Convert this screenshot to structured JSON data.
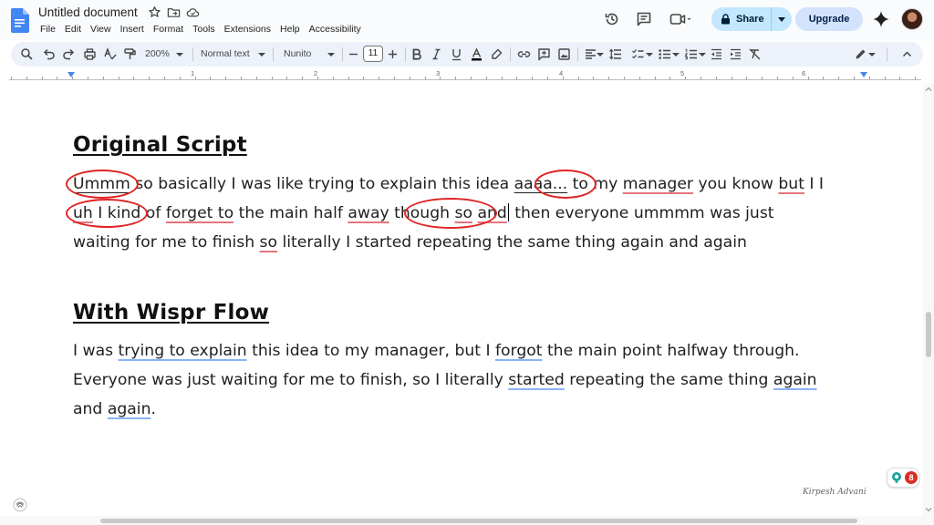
{
  "header": {
    "doc_title": "Untitled document",
    "menu": [
      "File",
      "Edit",
      "View",
      "Insert",
      "Format",
      "Tools",
      "Extensions",
      "Help",
      "Accessibility"
    ],
    "share_label": "Share",
    "upgrade_label": "Upgrade"
  },
  "toolbar": {
    "zoom": "200%",
    "style": "Normal text",
    "font": "Nunito",
    "font_size": "11"
  },
  "ruler": {
    "numbers": [
      "1",
      "2",
      "3",
      "4",
      "5",
      "6"
    ]
  },
  "document": {
    "heading1": "Original Script",
    "p1_line1": {
      "w1": "Ummm",
      "t1": " so basically I was like trying to explain this idea ",
      "w2": "aaaa...",
      "t2": " to my ",
      "w3": "manager",
      "t3": " you know ",
      "w4": "but",
      "t4": " I I"
    },
    "p1_line2": {
      "w1": "uh",
      "t0": " I ",
      "w1b": "kind",
      "t1": " of ",
      "w2": "forget to",
      "t2": " the main half ",
      "w3": "away",
      "t3": " ",
      "w4": "though",
      "t4": " ",
      "w5": "so",
      "t5": " ",
      "w6": "and",
      "t6": " then everyone ummmm was just"
    },
    "p1_line3": {
      "t1": "waiting for me to finish ",
      "w1": "so",
      "t2": " literally I started repeating the same thing again and again"
    },
    "heading2": "With Wispr Flow",
    "p2_line1": {
      "t1": "I was ",
      "w1": "trying to explain",
      "t2": " this idea to my manager, but I ",
      "w2": "forgot",
      "t3": " the main point halfway through."
    },
    "p2_line2": {
      "t1": "Everyone was just waiting for me to finish, so I literally ",
      "w1": "started",
      "t2": " repeating the same thing ",
      "w2": "again"
    },
    "p2_line3": {
      "t1": "and ",
      "w1": "again",
      "t2": "."
    }
  },
  "widgets": {
    "notification_count": "8",
    "signature": "Kirpesh Advani"
  },
  "colors": {
    "accent": "#c2e7ff",
    "upgrade": "#d3e3fd",
    "circle": "#e02424",
    "spell_red": "#e2767c",
    "grammar_blue": "#8ab4f8"
  }
}
